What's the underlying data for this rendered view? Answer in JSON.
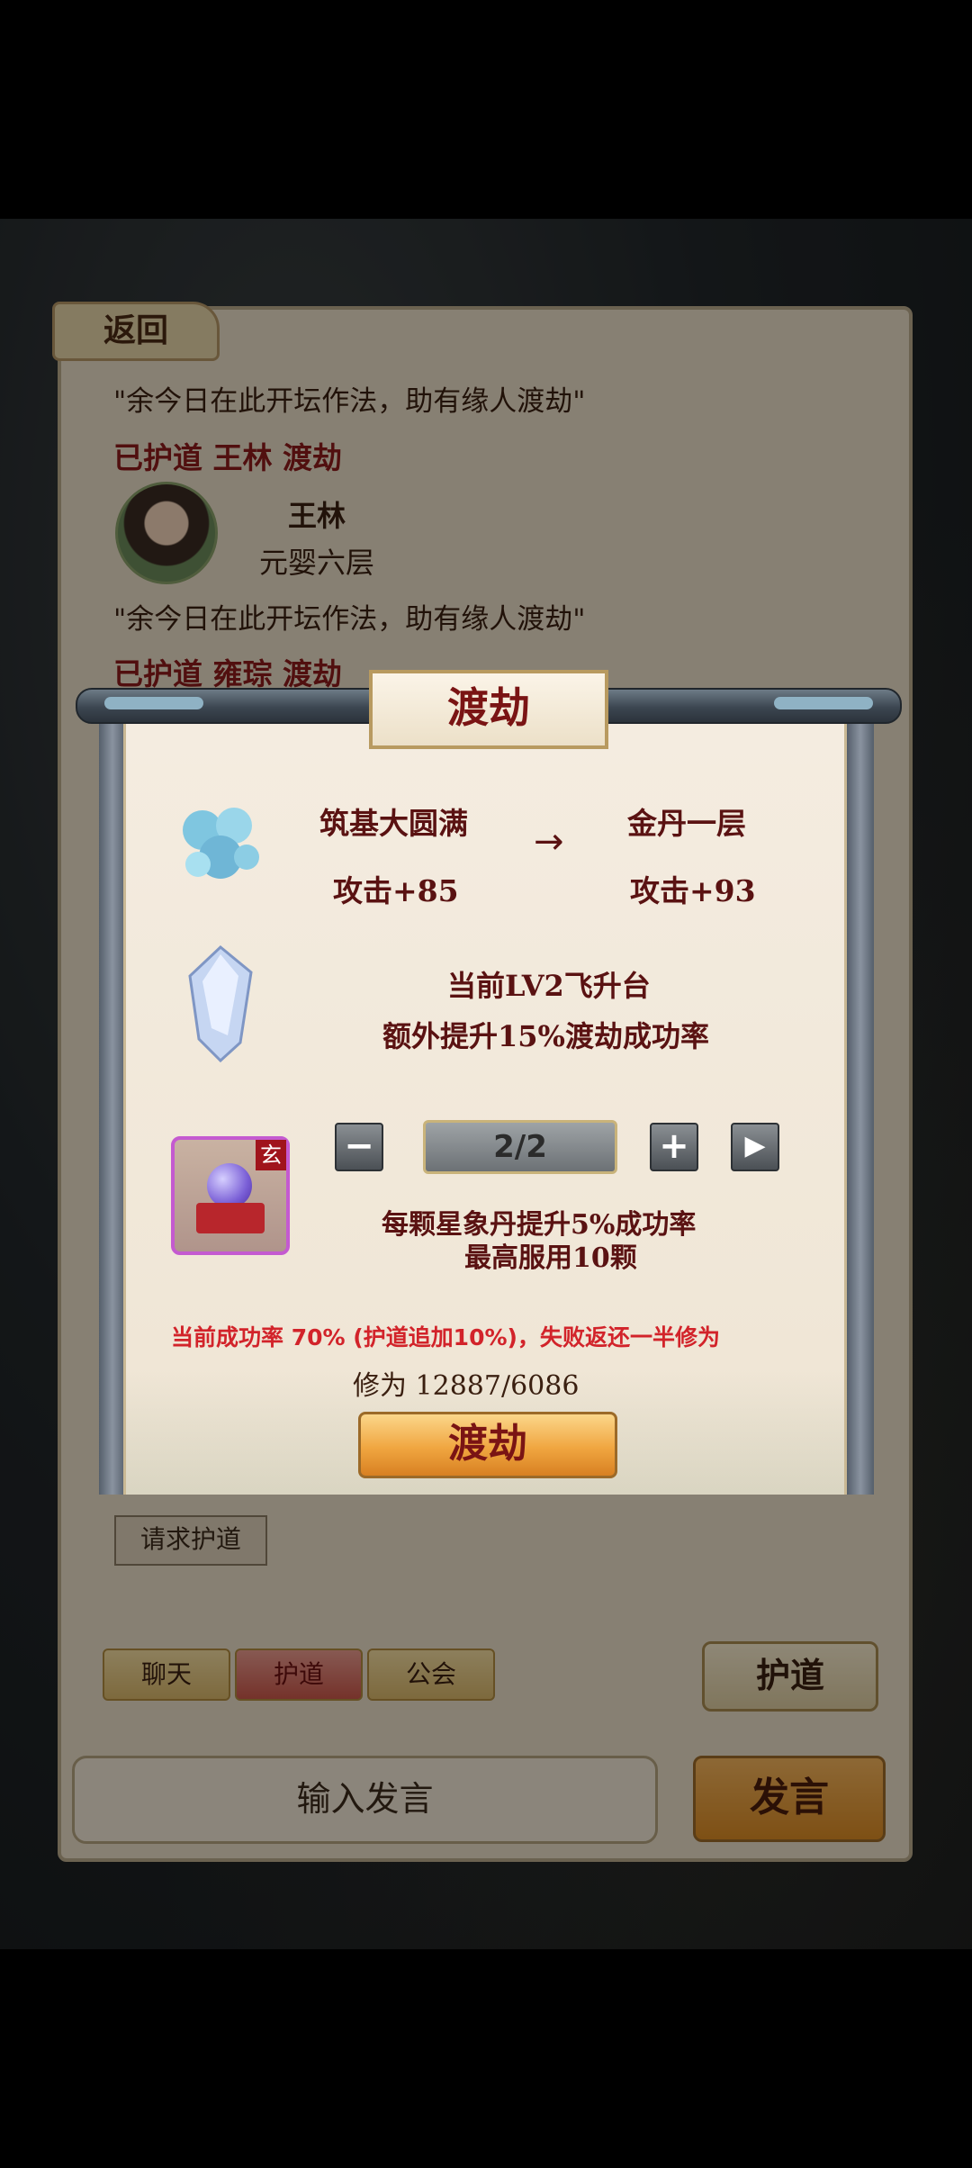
{
  "back": {
    "label": "返回"
  },
  "chat": {
    "messages": [
      {
        "text": "\"余今日在此开坛作法，助有缘人渡劫\""
      },
      {
        "notice": "已护道 王林 渡劫"
      },
      {
        "name": "王林",
        "rank": "元婴六层"
      },
      {
        "text": "\"余今日在此开坛作法，助有缘人渡劫\""
      },
      {
        "notice": "已护道 雍琮 渡劫"
      }
    ],
    "request_button": "请求护道",
    "tabs": [
      "聊天",
      "护道",
      "公会"
    ],
    "active_tab": 1,
    "hudao_button": "护道",
    "input_placeholder": "输入发言",
    "send_button": "发言"
  },
  "modal": {
    "title": "渡劫",
    "from_realm": "筑基大圆满",
    "to_realm": "金丹一层",
    "from_attack": "攻击+85",
    "to_attack": "攻击+93",
    "arrow": "→",
    "platform": "当前LV2飞升台",
    "platform_bonus": "额外提升15%渡劫成功率",
    "item_tag": "玄",
    "counter": "2/2",
    "minus": "−",
    "plus": "+",
    "next": "▶",
    "pill_desc1": "每颗星象丹提升5%成功率",
    "pill_desc2": "最高服用10颗",
    "success_line": "当前成功率  70% (护道追加10%)，失败返还一半修为",
    "cultivation": "修为 12887/6086",
    "confirm_button": "渡劫"
  },
  "colors": {
    "title_red": "#7a1414",
    "alert_red": "#d2232a",
    "active_tab": "#c9574a",
    "button_orange": "#f0a640"
  }
}
